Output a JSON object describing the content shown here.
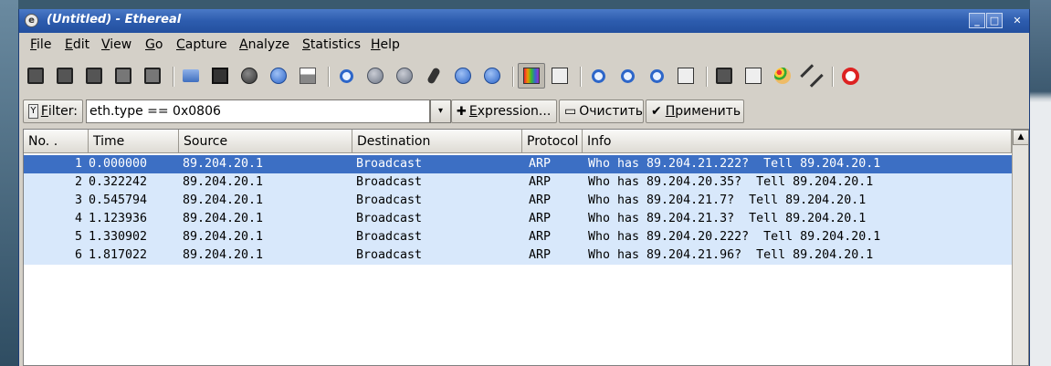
{
  "window": {
    "title": "(Untitled) - Ethereal",
    "app_icon_glyph": "e",
    "minimize_glyph": "_",
    "maximize_glyph": "□",
    "close_glyph": "✕"
  },
  "menu": [
    {
      "key": "F",
      "rest": "ile"
    },
    {
      "key": "E",
      "rest": "dit"
    },
    {
      "key": "V",
      "rest": "iew"
    },
    {
      "key": "G",
      "rest": "o"
    },
    {
      "key": "C",
      "rest": "apture"
    },
    {
      "key": "A",
      "rest": "nalyze"
    },
    {
      "key": "S",
      "rest": "tatistics"
    },
    {
      "key": "H",
      "rest": "elp"
    }
  ],
  "toolbar_icons": [
    "interfaces-icon",
    "capture-options-icon",
    "capture-start-icon",
    "capture-stop-icon",
    "capture-restart-icon",
    "open-icon",
    "save-icon",
    "close-icon",
    "reload-icon",
    "print-icon",
    "find-icon",
    "back-icon",
    "forward-icon",
    "goto-icon",
    "first-icon",
    "last-icon",
    "colorize-icon",
    "autoscroll-icon",
    "zoom-in-icon",
    "zoom-out-icon",
    "zoom-normal-icon",
    "resize-columns-icon",
    "capture-filter-icon",
    "display-filter-icon",
    "coloring-rules-icon",
    "preferences-icon",
    "help-icon"
  ],
  "filter": {
    "label_key": "F",
    "label_rest": "ilter:",
    "value": "eth.type == 0x0806",
    "dropdown_glyph": "▾",
    "expression_key": "E",
    "expression_rest": "xpression...",
    "clear_label": "Очистить",
    "apply_prefix": "П",
    "apply_rest": "рименить",
    "filter_icon_glyph": "Y",
    "clear_icon_glyph": "▭",
    "apply_icon_glyph": "✔",
    "expression_icon_glyph": "✚"
  },
  "packet_list": {
    "columns": [
      "No. .",
      "Time",
      "Source",
      "Destination",
      "Protocol",
      "Info"
    ],
    "rows": [
      {
        "no": "1",
        "time": "0.000000",
        "source": "89.204.20.1",
        "destination": "Broadcast",
        "protocol": "ARP",
        "info": "Who has 89.204.21.222?  Tell 89.204.20.1"
      },
      {
        "no": "2",
        "time": "0.322242",
        "source": "89.204.20.1",
        "destination": "Broadcast",
        "protocol": "ARP",
        "info": "Who has 89.204.20.35?  Tell 89.204.20.1"
      },
      {
        "no": "3",
        "time": "0.545794",
        "source": "89.204.20.1",
        "destination": "Broadcast",
        "protocol": "ARP",
        "info": "Who has 89.204.21.7?  Tell 89.204.20.1"
      },
      {
        "no": "4",
        "time": "1.123936",
        "source": "89.204.20.1",
        "destination": "Broadcast",
        "protocol": "ARP",
        "info": "Who has 89.204.21.3?  Tell 89.204.20.1"
      },
      {
        "no": "5",
        "time": "1.330902",
        "source": "89.204.20.1",
        "destination": "Broadcast",
        "protocol": "ARP",
        "info": "Who has 89.204.20.222?  Tell 89.204.20.1"
      },
      {
        "no": "6",
        "time": "1.817022",
        "source": "89.204.20.1",
        "destination": "Broadcast",
        "protocol": "ARP",
        "info": "Who has 89.204.21.96?  Tell 89.204.20.1"
      }
    ],
    "selected_row": 0,
    "scroll_up_glyph": "▲"
  },
  "colors": {
    "titlebar": "#2d5cae",
    "selected_row": "#3c6fc4",
    "row_bg": "#d8e8fb",
    "window_bg": "#d4d0c8"
  }
}
